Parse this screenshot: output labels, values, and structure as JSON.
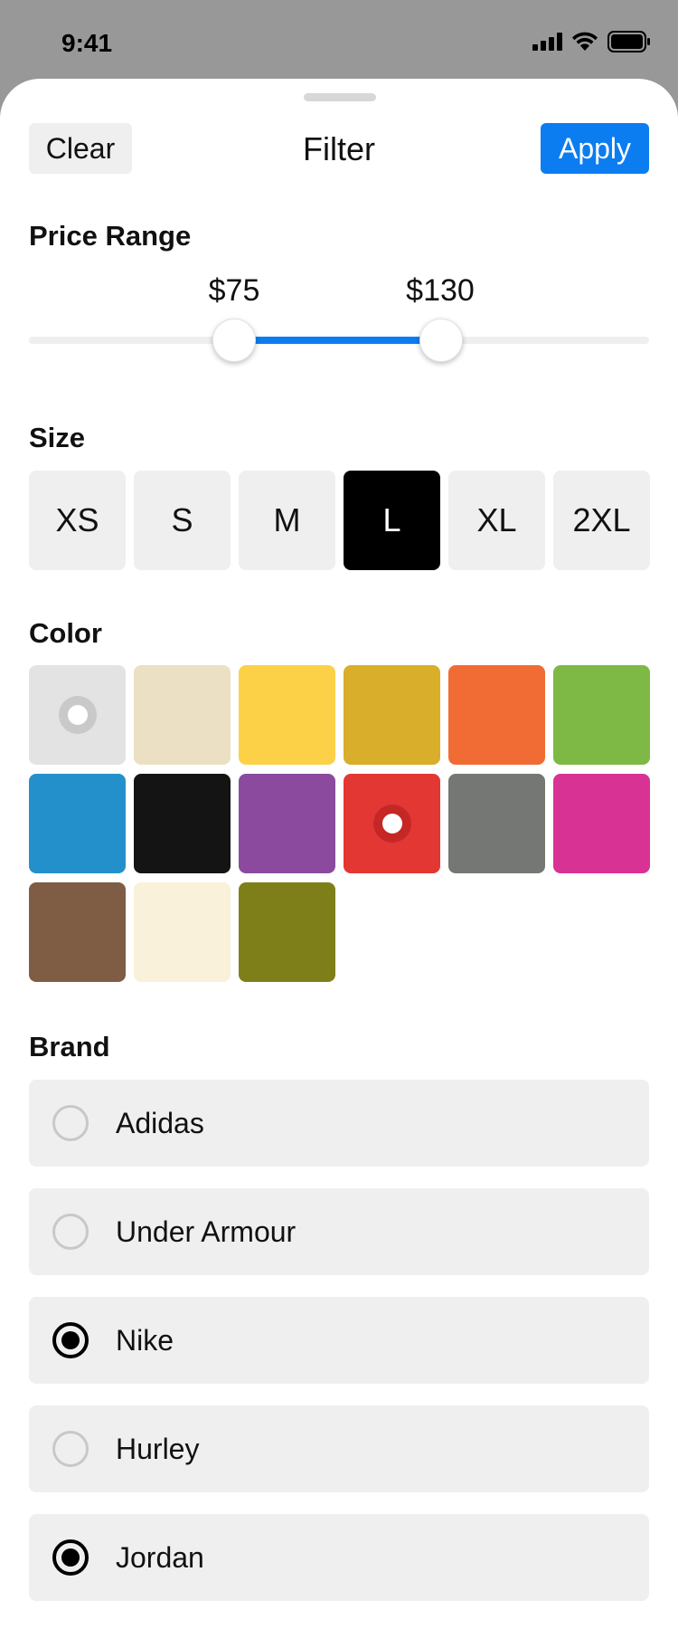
{
  "status_bar": {
    "time": "9:41",
    "icons": [
      "cellular-signal-icon",
      "wifi-icon",
      "battery-icon"
    ]
  },
  "header": {
    "title": "Filter",
    "clear_label": "Clear",
    "apply_label": "Apply"
  },
  "price": {
    "title": "Price Range",
    "min_label": "$75",
    "max_label": "$130",
    "min_value": 75,
    "max_value": 130
  },
  "size": {
    "title": "Size",
    "options": [
      "XS",
      "S",
      "M",
      "L",
      "XL",
      "2XL"
    ],
    "selected": "L"
  },
  "color": {
    "title": "Color",
    "swatches": [
      {
        "color": "#e3e3e3",
        "marked": true
      },
      {
        "color": "#ebe0c3",
        "marked": false
      },
      {
        "color": "#fcd148",
        "marked": false
      },
      {
        "color": "#d8ae2a",
        "marked": false
      },
      {
        "color": "#f16c34",
        "marked": false
      },
      {
        "color": "#7db944",
        "marked": false
      },
      {
        "color": "#2490cb",
        "marked": false
      },
      {
        "color": "#141414",
        "marked": false
      },
      {
        "color": "#8b4a9e",
        "marked": false
      },
      {
        "color": "#e33734",
        "marked": true,
        "selected": true
      },
      {
        "color": "#757775",
        "marked": false
      },
      {
        "color": "#d83294",
        "marked": false
      },
      {
        "color": "#7f5c44",
        "marked": false
      },
      {
        "color": "#faf1db",
        "marked": false
      },
      {
        "color": "#7f7f1a",
        "marked": false
      }
    ]
  },
  "brand": {
    "title": "Brand",
    "items": [
      {
        "label": "Adidas",
        "checked": false
      },
      {
        "label": "Under Armour",
        "checked": false
      },
      {
        "label": "Nike",
        "checked": true
      },
      {
        "label": "Hurley",
        "checked": false
      },
      {
        "label": "Jordan",
        "checked": true
      }
    ]
  },
  "accent_color": "#0b7df0"
}
